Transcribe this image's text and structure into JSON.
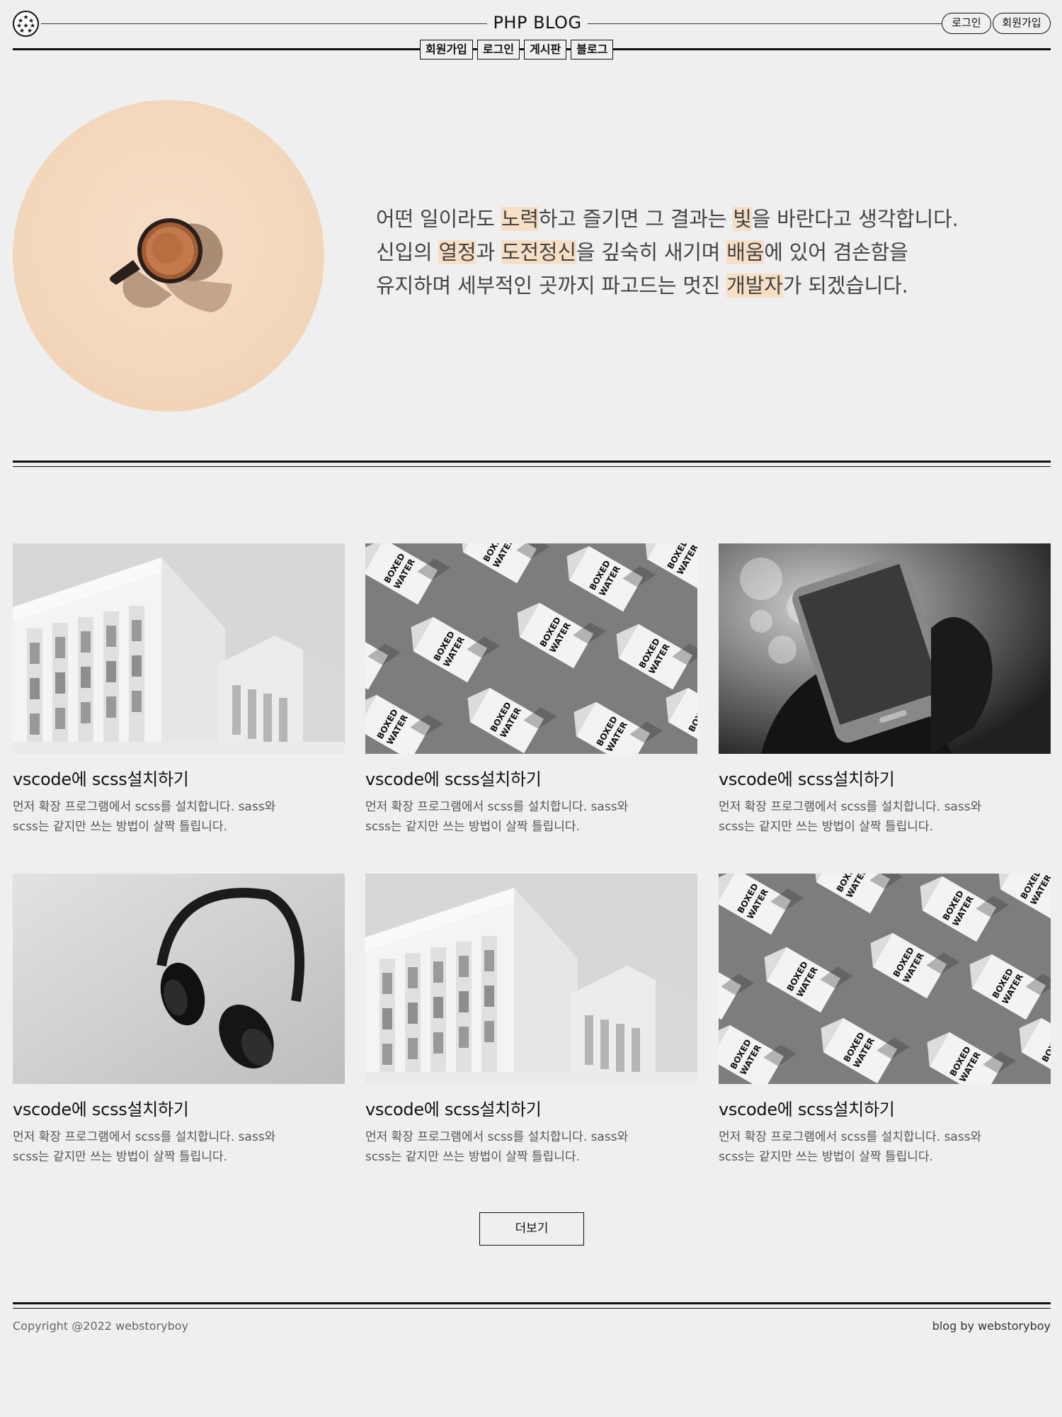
{
  "header": {
    "site_title": "PHP BLOG",
    "auth": {
      "login_label": "로그인",
      "signup_label": "회원가입"
    },
    "nav": [
      "회원가입",
      "로그인",
      "게시판",
      "블로그"
    ]
  },
  "hero": {
    "lines": [
      [
        {
          "t": "어떤 일이라도 ",
          "hl": false
        },
        {
          "t": "노력",
          "hl": true
        },
        {
          "t": "하고 즐기면 그 결과는 ",
          "hl": false
        },
        {
          "t": "빛",
          "hl": true
        },
        {
          "t": "을 바란다고 생각합니다.",
          "hl": false
        }
      ],
      [
        {
          "t": "신입의 ",
          "hl": false
        },
        {
          "t": "열정",
          "hl": true
        },
        {
          "t": "과 ",
          "hl": false
        },
        {
          "t": "도전정신",
          "hl": true
        },
        {
          "t": "을 깊숙히 새기며 ",
          "hl": false
        },
        {
          "t": "배움",
          "hl": true
        },
        {
          "t": "에 있어 겸손함을",
          "hl": false
        }
      ],
      [
        {
          "t": "유지하며 세부적인 곳까지 파고드는 멋진 ",
          "hl": false
        },
        {
          "t": "개발자",
          "hl": true
        },
        {
          "t": "가 되겠습니다.",
          "hl": false
        }
      ]
    ],
    "highlight_color": "#f7dfc6"
  },
  "posts": [
    {
      "image": "building",
      "title": "vscode에 scss설치하기",
      "desc_line1": "먼저 확장 프로그램에서 scss를 설치합니다. sass와",
      "desc_line2": "scss는 같지만 쓰는 방법이 살짝 틀립니다."
    },
    {
      "image": "boxed-water",
      "title": "vscode에 scss설치하기",
      "desc_line1": "먼저 확장 프로그램에서 scss를 설치합니다. sass와",
      "desc_line2": "scss는 같지만 쓰는 방법이 살짝 틀립니다."
    },
    {
      "image": "phone",
      "title": "vscode에 scss설치하기",
      "desc_line1": "먼저 확장 프로그램에서 scss를 설치합니다. sass와",
      "desc_line2": "scss는 같지만 쓰는 방법이 살짝 틀립니다."
    },
    {
      "image": "headphones",
      "title": "vscode에 scss설치하기",
      "desc_line1": "먼저 확장 프로그램에서 scss를 설치합니다. sass와",
      "desc_line2": "scss는 같지만 쓰는 방법이 살짝 틀립니다."
    },
    {
      "image": "building",
      "title": "vscode에 scss설치하기",
      "desc_line1": "먼저 확장 프로그램에서 scss를 설치합니다. sass와",
      "desc_line2": "scss는 같지만 쓰는 방법이 살짝 틀립니다."
    },
    {
      "image": "boxed-water",
      "title": "vscode에 scss설치하기",
      "desc_line1": "먼저 확장 프로그램에서 scss를 설치합니다. sass와",
      "desc_line2": "scss는 같지만 쓰는 방법이 살짝 틀립니다."
    }
  ],
  "more_label": "더보기",
  "footer": {
    "copyright": "Copyright @2022 webstoryboy",
    "credit": "blog by webstoryboy"
  },
  "carton_text": "BOXED WATER"
}
